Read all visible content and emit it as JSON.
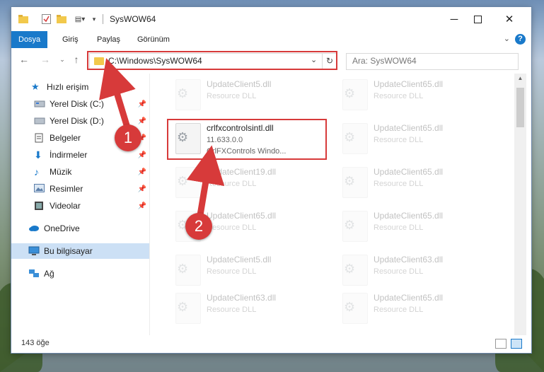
{
  "window": {
    "title": "SysWOW64"
  },
  "ribbon": {
    "tabs": [
      "Dosya",
      "Giriş",
      "Paylaş",
      "Görünüm"
    ],
    "help_label": "?"
  },
  "nav": {
    "address": "C:\\Windows\\SysWOW64",
    "search_placeholder": "Ara: SysWOW64"
  },
  "sidebar": {
    "items": [
      {
        "label": "Hızlı erişim",
        "icon": "star-icon",
        "pinned": false
      },
      {
        "label": "Yerel Disk (C:)",
        "icon": "drive-icon",
        "pinned": true
      },
      {
        "label": "Yerel Disk (D:)",
        "icon": "drive-icon",
        "pinned": true
      },
      {
        "label": "Belgeler",
        "icon": "documents-icon",
        "pinned": true
      },
      {
        "label": "İndirmeler",
        "icon": "download-icon",
        "pinned": true
      },
      {
        "label": "Müzik",
        "icon": "music-icon",
        "pinned": true
      },
      {
        "label": "Resimler",
        "icon": "pictures-icon",
        "pinned": true
      },
      {
        "label": "Videolar",
        "icon": "videos-icon",
        "pinned": true
      },
      {
        "label": "OneDrive",
        "icon": "cloud-icon",
        "pinned": false
      },
      {
        "label": "Bu bilgisayar",
        "icon": "computer-icon",
        "pinned": false
      },
      {
        "label": "Ağ",
        "icon": "network-icon",
        "pinned": false
      }
    ]
  },
  "files": {
    "highlighted": {
      "name": "crlfxcontrolsintl.dll",
      "version": "11.633.0.0",
      "description": "CrlFXControls Windo..."
    },
    "faded_left": [
      {
        "name": "UpdateClient5.dll",
        "type": "Resource DLL"
      },
      {
        "name": "UpdateClient19.dll",
        "type": "Resource DLL"
      },
      {
        "name": "UpdateClient65.dll",
        "type": "Resource DLL"
      },
      {
        "name": "UpdateClient5.dll",
        "type": "Resource DLL"
      },
      {
        "name": "UpdateClient63.dll",
        "type": "Resource DLL"
      }
    ],
    "faded_right": [
      {
        "name": "UpdateClient65.dll",
        "type": "Resource DLL"
      },
      {
        "name": "UpdateClient65.dll",
        "type": "Resource DLL"
      },
      {
        "name": "UpdateClient65.dll",
        "type": "Resource DLL"
      },
      {
        "name": "UpdateClient65.dll",
        "type": "Resource DLL"
      },
      {
        "name": "UpdateClient63.dll",
        "type": "Resource DLL"
      },
      {
        "name": "UpdateClient65.dll",
        "type": "Resource DLL"
      }
    ]
  },
  "status": {
    "count": "143 öğe"
  },
  "annotations": {
    "badge1": "1",
    "badge2": "2",
    "color": "#d73a3a"
  }
}
